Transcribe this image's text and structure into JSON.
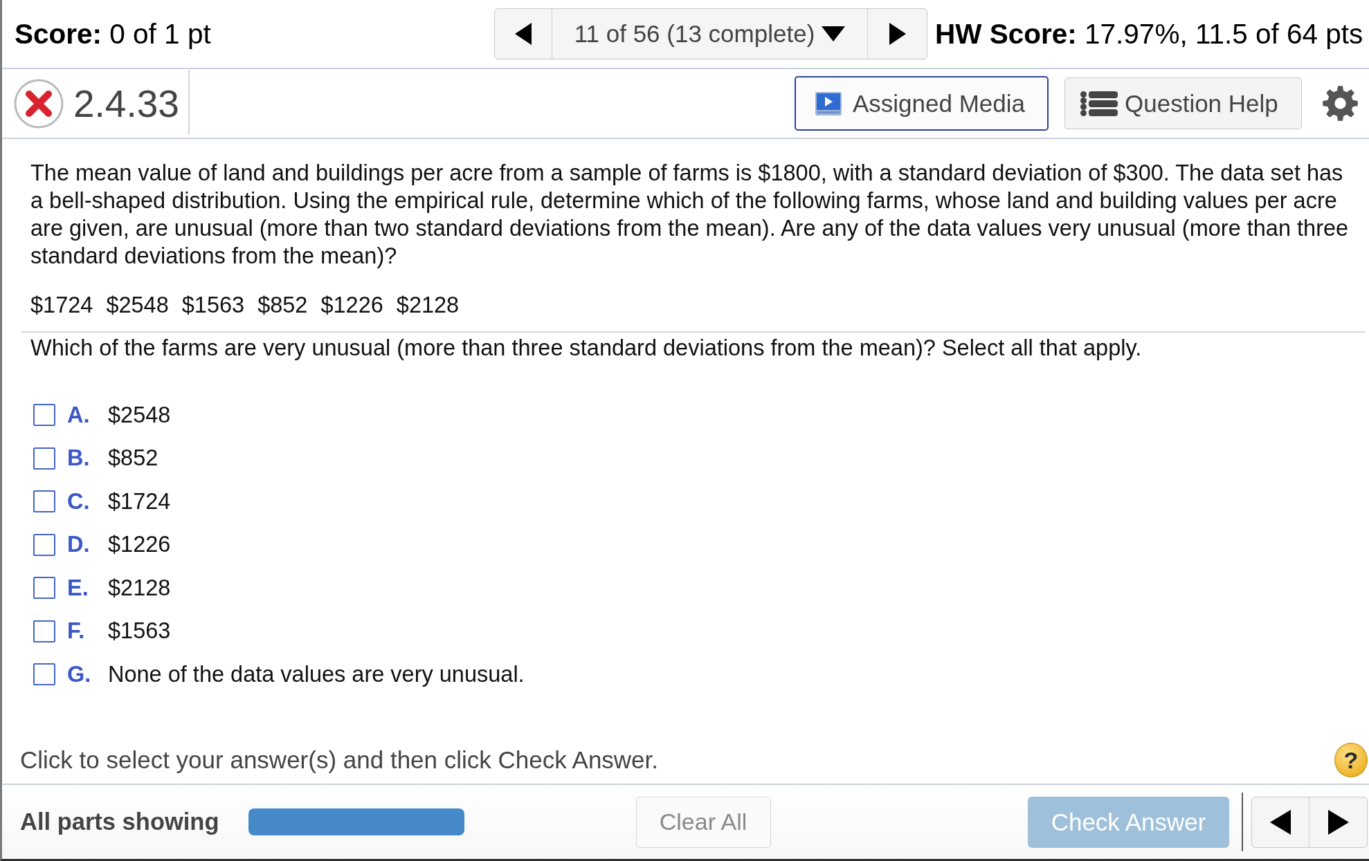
{
  "header": {
    "score": "**Score:** 0 of 1 pt",
    "nav": {
      "position": "11 of 56 (13 complete)"
    },
    "hw_score": "**HW Score:** 17.97%, 11.5 of 64 pts"
  },
  "question_bar": {
    "incorrect": true,
    "number": "2.4.33",
    "buttons": [
      {
        "kind": "media",
        "label": "Assigned Media"
      },
      {
        "kind": "help",
        "label": "Question Help"
      }
    ]
  },
  "question": {
    "text": "The mean value of land and buildings per acre from a sample of farms is $1800, with a standard deviation of $300. The data set has a bell-shaped distribution. Using the empirical rule, determine which of the following farms, whose land and building values per acre are given, are unusual (more than two standard deviations from the mean). Are any of the data values very unusual (more than three standard deviations from the mean)?",
    "data_values": [
      "$1724",
      "$2548",
      "$1563",
      "$852",
      "$1226",
      "$2128"
    ],
    "prompt": "Which of the farms are very unusual (more than three standard deviations from the mean)? Select all that apply.",
    "options": [
      {
        "letter": "A.",
        "text": "$2548",
        "checked": false
      },
      {
        "letter": "B.",
        "text": "$852",
        "checked": false
      },
      {
        "letter": "C.",
        "text": "$1724",
        "checked": false
      },
      {
        "letter": "D.",
        "text": "$1226",
        "checked": false
      },
      {
        "letter": "E.",
        "text": "$2128",
        "checked": false
      },
      {
        "letter": "F.",
        "text": "$1563",
        "checked": false
      },
      {
        "letter": "G.",
        "text": "None of the data values are very unusual.",
        "checked": false
      }
    ]
  },
  "instruction": {
    "text": "Click to select your answer(s) and then click Check Answer.",
    "help_button": "?"
  },
  "footer": {
    "parts_label": "All parts showing",
    "clear_button": {
      "label": "Clear All",
      "disabled": true
    },
    "check_button": {
      "label": "Check Answer",
      "disabled": true
    }
  }
}
